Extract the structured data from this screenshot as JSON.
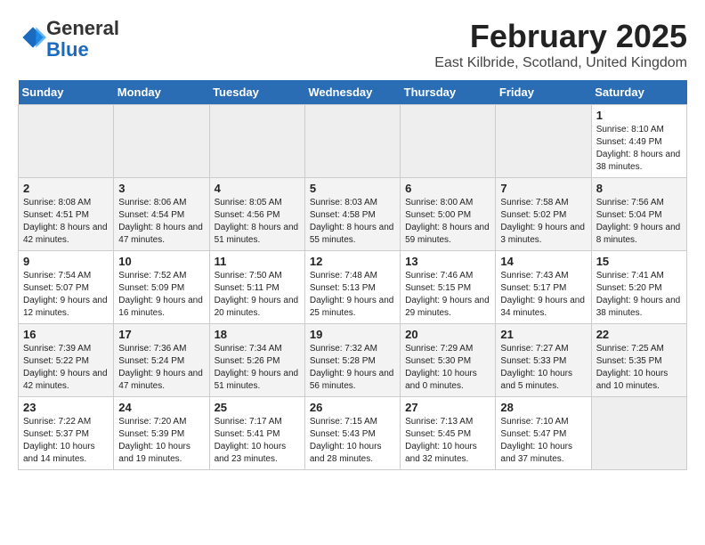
{
  "header": {
    "logo_line1": "General",
    "logo_line2": "Blue",
    "title": "February 2025",
    "subtitle": "East Kilbride, Scotland, United Kingdom"
  },
  "days_of_week": [
    "Sunday",
    "Monday",
    "Tuesday",
    "Wednesday",
    "Thursday",
    "Friday",
    "Saturday"
  ],
  "weeks": [
    [
      {
        "day": "",
        "info": ""
      },
      {
        "day": "",
        "info": ""
      },
      {
        "day": "",
        "info": ""
      },
      {
        "day": "",
        "info": ""
      },
      {
        "day": "",
        "info": ""
      },
      {
        "day": "",
        "info": ""
      },
      {
        "day": "1",
        "info": "Sunrise: 8:10 AM\nSunset: 4:49 PM\nDaylight: 8 hours and 38 minutes."
      }
    ],
    [
      {
        "day": "2",
        "info": "Sunrise: 8:08 AM\nSunset: 4:51 PM\nDaylight: 8 hours and 42 minutes."
      },
      {
        "day": "3",
        "info": "Sunrise: 8:06 AM\nSunset: 4:54 PM\nDaylight: 8 hours and 47 minutes."
      },
      {
        "day": "4",
        "info": "Sunrise: 8:05 AM\nSunset: 4:56 PM\nDaylight: 8 hours and 51 minutes."
      },
      {
        "day": "5",
        "info": "Sunrise: 8:03 AM\nSunset: 4:58 PM\nDaylight: 8 hours and 55 minutes."
      },
      {
        "day": "6",
        "info": "Sunrise: 8:00 AM\nSunset: 5:00 PM\nDaylight: 8 hours and 59 minutes."
      },
      {
        "day": "7",
        "info": "Sunrise: 7:58 AM\nSunset: 5:02 PM\nDaylight: 9 hours and 3 minutes."
      },
      {
        "day": "8",
        "info": "Sunrise: 7:56 AM\nSunset: 5:04 PM\nDaylight: 9 hours and 8 minutes."
      }
    ],
    [
      {
        "day": "9",
        "info": "Sunrise: 7:54 AM\nSunset: 5:07 PM\nDaylight: 9 hours and 12 minutes."
      },
      {
        "day": "10",
        "info": "Sunrise: 7:52 AM\nSunset: 5:09 PM\nDaylight: 9 hours and 16 minutes."
      },
      {
        "day": "11",
        "info": "Sunrise: 7:50 AM\nSunset: 5:11 PM\nDaylight: 9 hours and 20 minutes."
      },
      {
        "day": "12",
        "info": "Sunrise: 7:48 AM\nSunset: 5:13 PM\nDaylight: 9 hours and 25 minutes."
      },
      {
        "day": "13",
        "info": "Sunrise: 7:46 AM\nSunset: 5:15 PM\nDaylight: 9 hours and 29 minutes."
      },
      {
        "day": "14",
        "info": "Sunrise: 7:43 AM\nSunset: 5:17 PM\nDaylight: 9 hours and 34 minutes."
      },
      {
        "day": "15",
        "info": "Sunrise: 7:41 AM\nSunset: 5:20 PM\nDaylight: 9 hours and 38 minutes."
      }
    ],
    [
      {
        "day": "16",
        "info": "Sunrise: 7:39 AM\nSunset: 5:22 PM\nDaylight: 9 hours and 42 minutes."
      },
      {
        "day": "17",
        "info": "Sunrise: 7:36 AM\nSunset: 5:24 PM\nDaylight: 9 hours and 47 minutes."
      },
      {
        "day": "18",
        "info": "Sunrise: 7:34 AM\nSunset: 5:26 PM\nDaylight: 9 hours and 51 minutes."
      },
      {
        "day": "19",
        "info": "Sunrise: 7:32 AM\nSunset: 5:28 PM\nDaylight: 9 hours and 56 minutes."
      },
      {
        "day": "20",
        "info": "Sunrise: 7:29 AM\nSunset: 5:30 PM\nDaylight: 10 hours and 0 minutes."
      },
      {
        "day": "21",
        "info": "Sunrise: 7:27 AM\nSunset: 5:33 PM\nDaylight: 10 hours and 5 minutes."
      },
      {
        "day": "22",
        "info": "Sunrise: 7:25 AM\nSunset: 5:35 PM\nDaylight: 10 hours and 10 minutes."
      }
    ],
    [
      {
        "day": "23",
        "info": "Sunrise: 7:22 AM\nSunset: 5:37 PM\nDaylight: 10 hours and 14 minutes."
      },
      {
        "day": "24",
        "info": "Sunrise: 7:20 AM\nSunset: 5:39 PM\nDaylight: 10 hours and 19 minutes."
      },
      {
        "day": "25",
        "info": "Sunrise: 7:17 AM\nSunset: 5:41 PM\nDaylight: 10 hours and 23 minutes."
      },
      {
        "day": "26",
        "info": "Sunrise: 7:15 AM\nSunset: 5:43 PM\nDaylight: 10 hours and 28 minutes."
      },
      {
        "day": "27",
        "info": "Sunrise: 7:13 AM\nSunset: 5:45 PM\nDaylight: 10 hours and 32 minutes."
      },
      {
        "day": "28",
        "info": "Sunrise: 7:10 AM\nSunset: 5:47 PM\nDaylight: 10 hours and 37 minutes."
      },
      {
        "day": "",
        "info": ""
      }
    ]
  ]
}
